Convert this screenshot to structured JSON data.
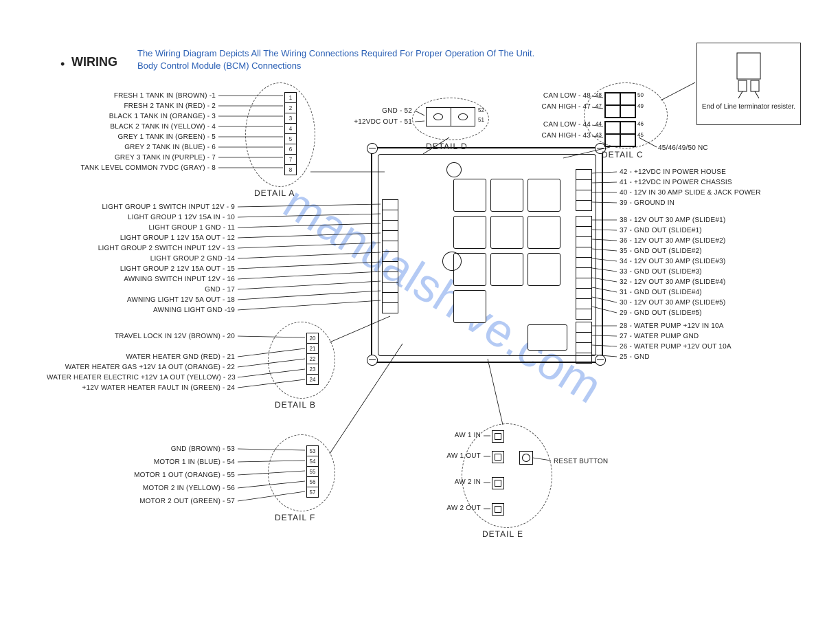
{
  "header": {
    "bullet": "•",
    "title": "WIRING",
    "desc1": "The Wiring Diagram Depicts All The Wiring Connections Required For Proper Operation Of The Unit.",
    "desc2": "Body Control Module (BCM) Connections"
  },
  "resistor_note": "End of Line terminator resister.",
  "nc_note": "45/46/49/50 NC",
  "reset_label": "RESET BUTTON",
  "watermark": "manualshive.com",
  "details": {
    "A": "DETAIL A",
    "B": "DETAIL B",
    "C": "DETAIL C",
    "D": "DETAIL D",
    "E": "DETAIL E",
    "F": "DETAIL F"
  },
  "detail_a_pins": [
    "1",
    "2",
    "3",
    "4",
    "5",
    "6",
    "7",
    "8"
  ],
  "detail_a": [
    "FRESH 1 TANK IN  (BROWN) -1",
    "FRESH 2 TANK IN  (RED) - 2",
    "BLACK 1 TANK IN  (ORANGE) - 3",
    "BLACK 2 TANK IN  (YELLOW) - 4",
    "GREY  1 TANK IN  (GREEN) - 5",
    "GREY  2 TANK IN  (BLUE) - 6",
    "GREY  3 TANK IN  (PURPLE) - 7",
    "TANK LEVEL COMMON 7VDC (GRAY) - 8"
  ],
  "left_mid": [
    "LIGHT GROUP 1 SWITCH INPUT 12V - 9",
    "LIGHT GROUP 1 12V 15A IN - 10",
    "LIGHT GROUP 1 GND - 11",
    "LIGHT GROUP 1  12V 15A OUT - 12",
    "LIGHT GROUP 2 SWITCH INPUT 12V - 13",
    "LIGHT GROUP 2 GND -14",
    "LIGHT GROUP 2 12V 15A OUT - 15",
    "AWNING SWITCH INPUT 12V - 16",
    "GND - 17",
    "AWNING LIGHT 12V 5A OUT - 18",
    "AWNING LIGHT GND -19"
  ],
  "detail_b_pins": [
    "20",
    "21",
    "22",
    "23",
    "24"
  ],
  "detail_b": [
    "TRAVEL LOCK IN 12V (BROWN) - 20",
    "WATER HEATER GND (RED) - 21",
    "WATER HEATER GAS +12V 1A OUT (ORANGE) - 22",
    "WATER HEATER ELECTRIC +12V 1A OUT (YELLOW) - 23",
    "+12V WATER HEATER FAULT IN (GREEN) - 24"
  ],
  "detail_f_pins": [
    "53",
    "54",
    "55",
    "56",
    "57"
  ],
  "detail_f": [
    "GND (BROWN) - 53",
    "MOTOR 1 IN (BLUE) - 54",
    "MOTOR 1 OUT (ORANGE) - 55",
    "MOTOR 2 IN (YELLOW) - 56",
    "MOTOR 2 OUT  (GREEN) - 57"
  ],
  "detail_d": [
    "GND - 52",
    "+12VDC OUT - 51"
  ],
  "detail_d_pins": [
    "52",
    "51"
  ],
  "detail_c": [
    "CAN LOW - 48",
    "CAN HIGH - 47",
    "CAN LOW - 44",
    "CAN HIGH - 43"
  ],
  "detail_c_pins_left": [
    "48",
    "47",
    "44",
    "43"
  ],
  "detail_c_pins_right": [
    "50",
    "49",
    "46",
    "45"
  ],
  "right_top": [
    "42 - +12VDC IN POWER HOUSE",
    "41 - +12VDC IN POWER CHASSIS",
    "40 - 12V IN 30 AMP SLIDE & JACK POWER",
    "39 - GROUND IN"
  ],
  "right_mid": [
    "38 - 12V OUT 30 AMP (SLIDE#1)",
    "37 - GND OUT (SLIDE#1)",
    "36 - 12V OUT 30 AMP (SLIDE#2)",
    "35 - GND OUT (SLIDE#2)",
    "34 - 12V OUT 30 AMP (SLIDE#3)",
    "33 - GND OUT (SLIDE#3)",
    "32 - 12V OUT 30 AMP (SLIDE#4)",
    "31 - GND OUT (SLIDE#4)",
    "30 - 12V OUT 30 AMP (SLIDE#5)",
    "29 - GND OUT (SLIDE#5)"
  ],
  "right_low": [
    "28 - WATER PUMP +12V IN 10A",
    "27 - WATER PUMP GND",
    "26 - WATER PUMP +12V OUT 10A",
    "25 - GND"
  ],
  "detail_e": [
    "AW 1 IN",
    "AW 1 OUT",
    "AW 2 IN",
    "AW 2 OUT"
  ]
}
